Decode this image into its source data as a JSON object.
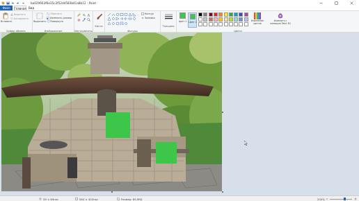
{
  "window": {
    "title": "ba029663f6e35c3f52dd583b41a8b12 - Paint",
    "minimize_icon": "minimize-icon",
    "maximize_icon": "maximize-icon",
    "close_icon": "close-icon"
  },
  "tabs": {
    "file": "Файл",
    "home": "Главная",
    "view": "Вид"
  },
  "ribbon": {
    "clipboard": {
      "label": "Буфер обмена",
      "paste": "Вставить",
      "cut": "Вырезать",
      "copy": "Копировать"
    },
    "image": {
      "label": "Изображение",
      "select": "Выделить",
      "crop": "Обрезать",
      "resize": "Изменить размер",
      "rotate": "Повернуть"
    },
    "tools": {
      "label": "Инструменты"
    },
    "brushes": {
      "label": "Кисти"
    },
    "shapes": {
      "label": "Фигуры",
      "outline": "Контур",
      "fill": "Заливка"
    },
    "size": {
      "label": "Толщина"
    },
    "colors": {
      "label": "Цвета",
      "color1": "Цвет 1",
      "color2": "Цвет 2",
      "edit": "Изменение цветов",
      "paint3d": "Изменить с помощью Paint 3D",
      "color1_value": "#3cc74b",
      "color2_value": "#3cc74b",
      "palette_row1": [
        "#000000",
        "#7f7f7f",
        "#880015",
        "#ed1c24",
        "#ff7f27",
        "#fff200",
        "#22b14c",
        "#00a2e8",
        "#3f48cc",
        "#a349a4"
      ],
      "palette_row2": [
        "#ffffff",
        "#c3c3c3",
        "#b97a57",
        "#ffaec9",
        "#ffc90e",
        "#efe4b0",
        "#b5e61d",
        "#99d9ea",
        "#7092be",
        "#c8bfe7"
      ],
      "palette_row3": [
        "#ffffff",
        "#ffffff",
        "#ffffff",
        "#ffffff",
        "#ffffff",
        "#ffffff",
        "#ffffff",
        "#ffffff",
        "#ffffff",
        "#ffffff"
      ]
    }
  },
  "canvas": {
    "marker_color": "#3cc74b"
  },
  "statusbar": {
    "cursor_pos": "59 × 69пкс",
    "selection_size": "",
    "image_size": "564 × 403пкс",
    "file_size": "Размер: 69,9КБ",
    "zoom": "200%"
  }
}
